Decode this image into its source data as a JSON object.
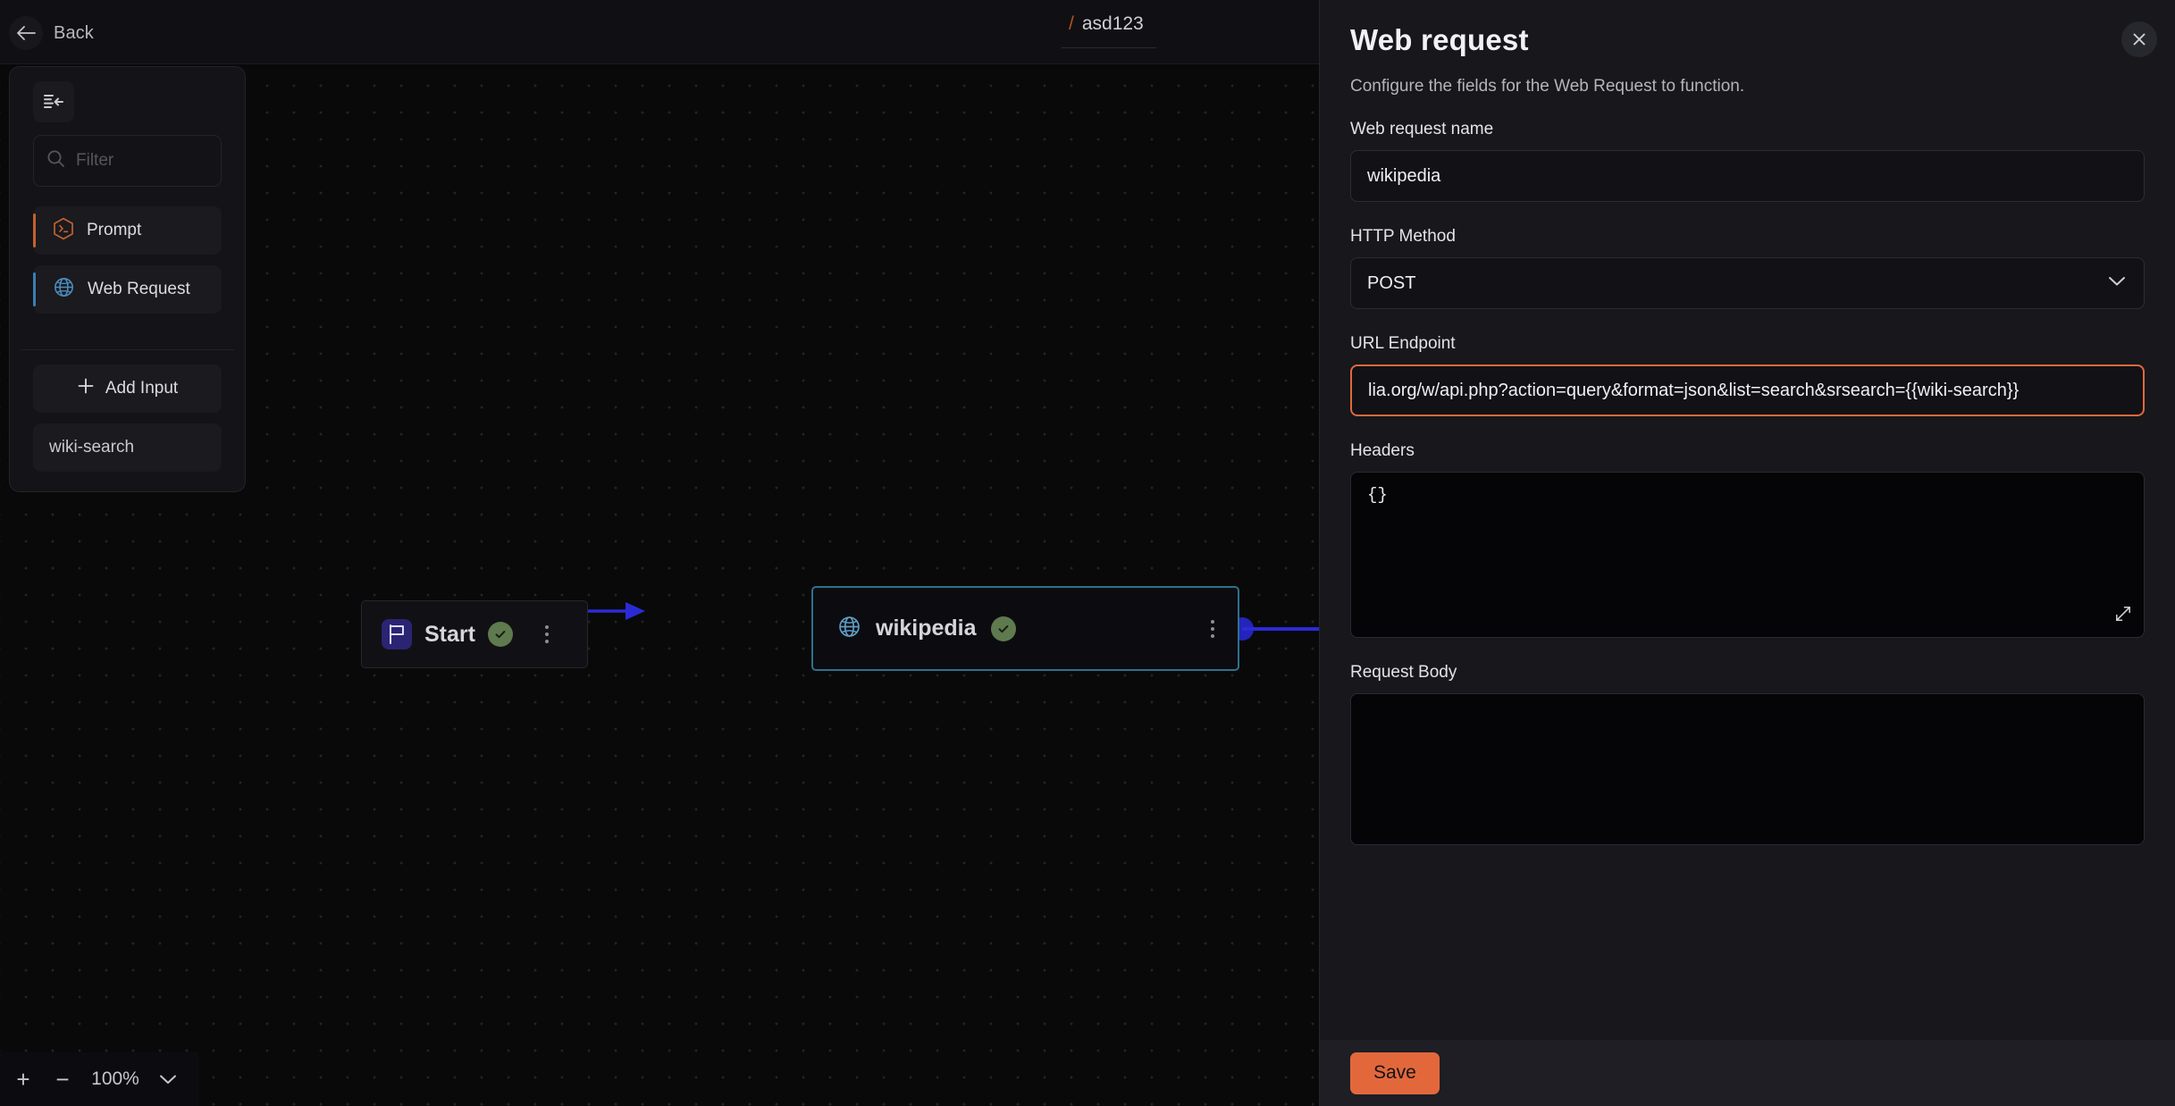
{
  "topbar": {
    "back_label": "Back",
    "breadcrumb_slash": "/",
    "breadcrumb_name": "asd123"
  },
  "palette": {
    "collapse_icon": "collapse-sidebar-icon",
    "filter_placeholder": "Filter",
    "items": [
      {
        "label": "Prompt",
        "icon": "terminal-hex-icon",
        "accent": "#c2622c"
      },
      {
        "label": "Web Request",
        "icon": "globe-icon",
        "accent": "#3a7fb5"
      }
    ],
    "add_input_label": "Add Input",
    "inputs": [
      {
        "label": "wiki-search"
      }
    ]
  },
  "canvas": {
    "nodes": [
      {
        "id": "start",
        "title": "Start",
        "icon": "flag-icon",
        "status": "check-icon",
        "selected": false
      },
      {
        "id": "wikipedia",
        "title": "wikipedia",
        "icon": "globe-icon",
        "status": "check-icon",
        "selected": true
      }
    ],
    "zoom": {
      "zoom_in_label": "+",
      "zoom_out_label": "−",
      "level": "100%"
    }
  },
  "panel": {
    "title": "Web request",
    "subtitle": "Configure the fields for the Web Request to function.",
    "close_label": "✕",
    "fields": {
      "name_label": "Web request name",
      "name_value": "wikipedia",
      "name_placeholder": "Web request name",
      "method_label": "HTTP Method",
      "method_value": "POST",
      "url_label": "URL Endpoint",
      "url_value": "lia.org/w/api.php?action=query&format=json&list=search&srsearch={{wiki-search}}",
      "url_placeholder": "https://",
      "headers_label": "Headers",
      "headers_value": "{}",
      "body_label": "Request Body",
      "body_value": "",
      "body_placeholder": ""
    },
    "save_label": "Save",
    "accent_color": "#e2683c",
    "selected_node_border": "#2f708c"
  }
}
